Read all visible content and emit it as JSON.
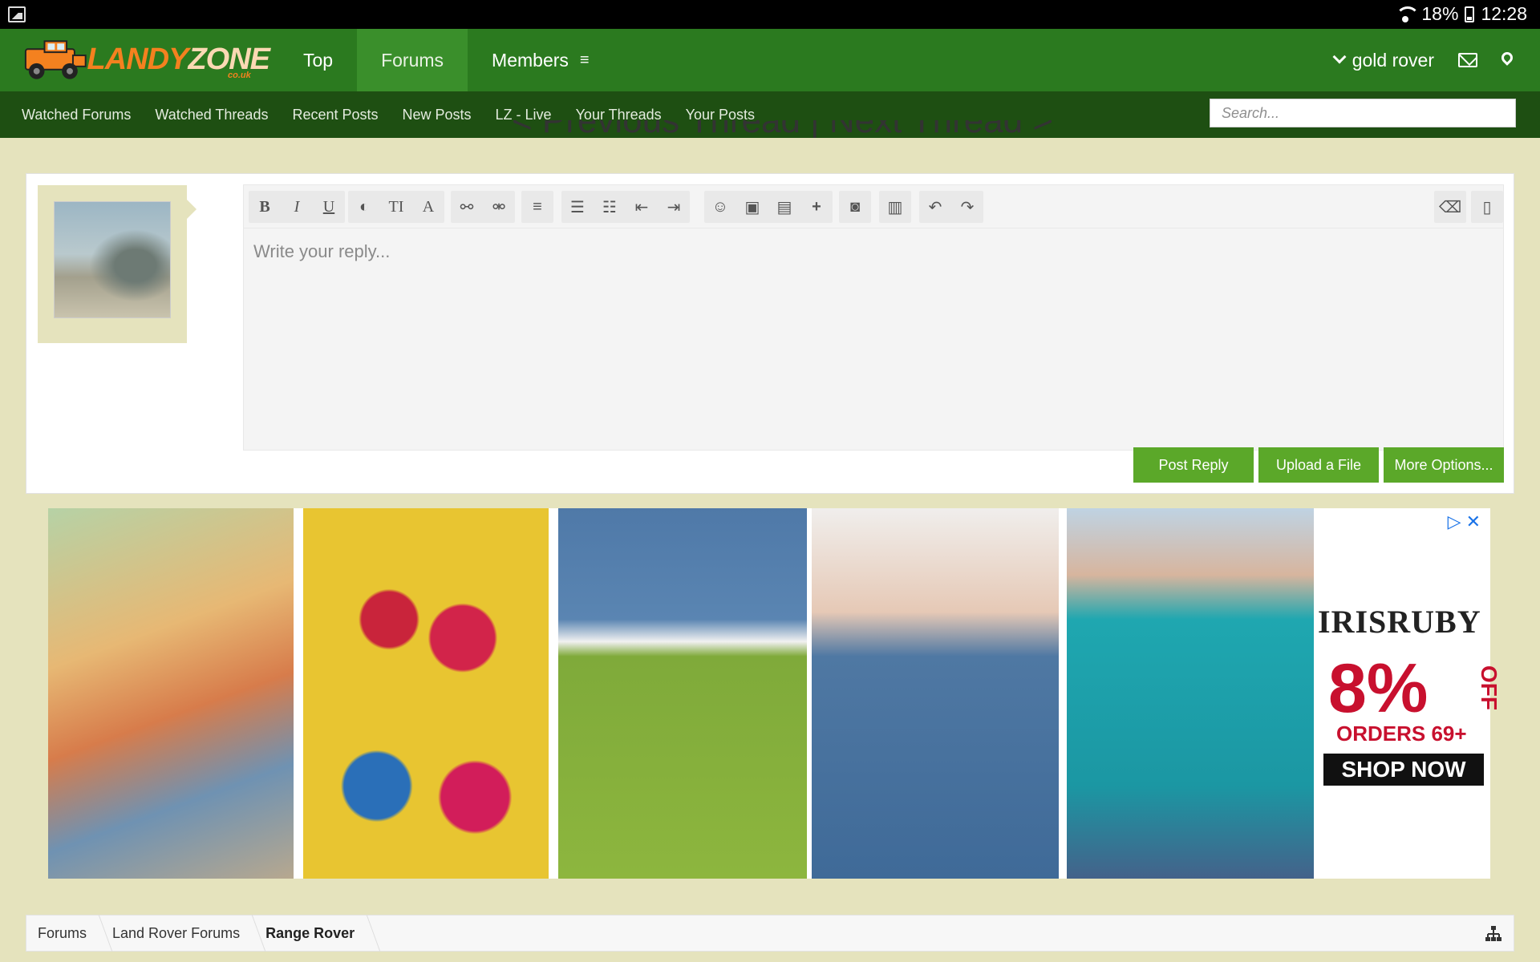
{
  "status_bar": {
    "battery": "18%",
    "time": "12:28"
  },
  "header": {
    "logo": {
      "word1": "LANDY",
      "word2": "ZONE",
      "suffix": "co.uk"
    },
    "tabs": [
      {
        "label": "Top"
      },
      {
        "label": "Forums"
      },
      {
        "label": "Members"
      }
    ],
    "active_tab": "Forums",
    "username": "gold rover"
  },
  "subnav": {
    "links": [
      "Watched Forums",
      "Watched Threads",
      "Recent Posts",
      "New Posts",
      "LZ - Live",
      "Your Threads",
      "Your Posts"
    ],
    "search_placeholder": "Search..."
  },
  "thread_nav": {
    "text": "< Previous Thread | Next Thread >"
  },
  "editor": {
    "placeholder": "Write your reply...",
    "toolbar_icons": [
      "bold-icon",
      "italic-icon",
      "underline-icon",
      "color-icon",
      "font-size-icon",
      "font-family-icon",
      "link-icon",
      "unlink-icon",
      "align-icon",
      "bullet-list-icon",
      "numbered-list-icon",
      "outdent-icon",
      "indent-icon",
      "smilie-icon",
      "image-icon",
      "media-icon",
      "insert-icon",
      "photo-icon",
      "save-draft-icon",
      "undo-icon",
      "redo-icon",
      "remove-format-icon",
      "source-icon"
    ]
  },
  "actions": {
    "post_reply": "Post Reply",
    "upload_file": "Upload a File",
    "more_options": "More Options..."
  },
  "ad": {
    "brand": "IRISRUBY",
    "discount": "8%",
    "off": "OFF",
    "condition": "ORDERS 69+",
    "cta": "SHOP NOW"
  },
  "breadcrumb": [
    "Forums",
    "Land Rover Forums",
    "Range Rover"
  ],
  "colors": {
    "header_green": "#2b7a1f",
    "subnav_green": "#1e4f12",
    "button_green": "#5ba829",
    "page_bg": "#e5e3bd",
    "logo_orange": "#f4811f"
  }
}
